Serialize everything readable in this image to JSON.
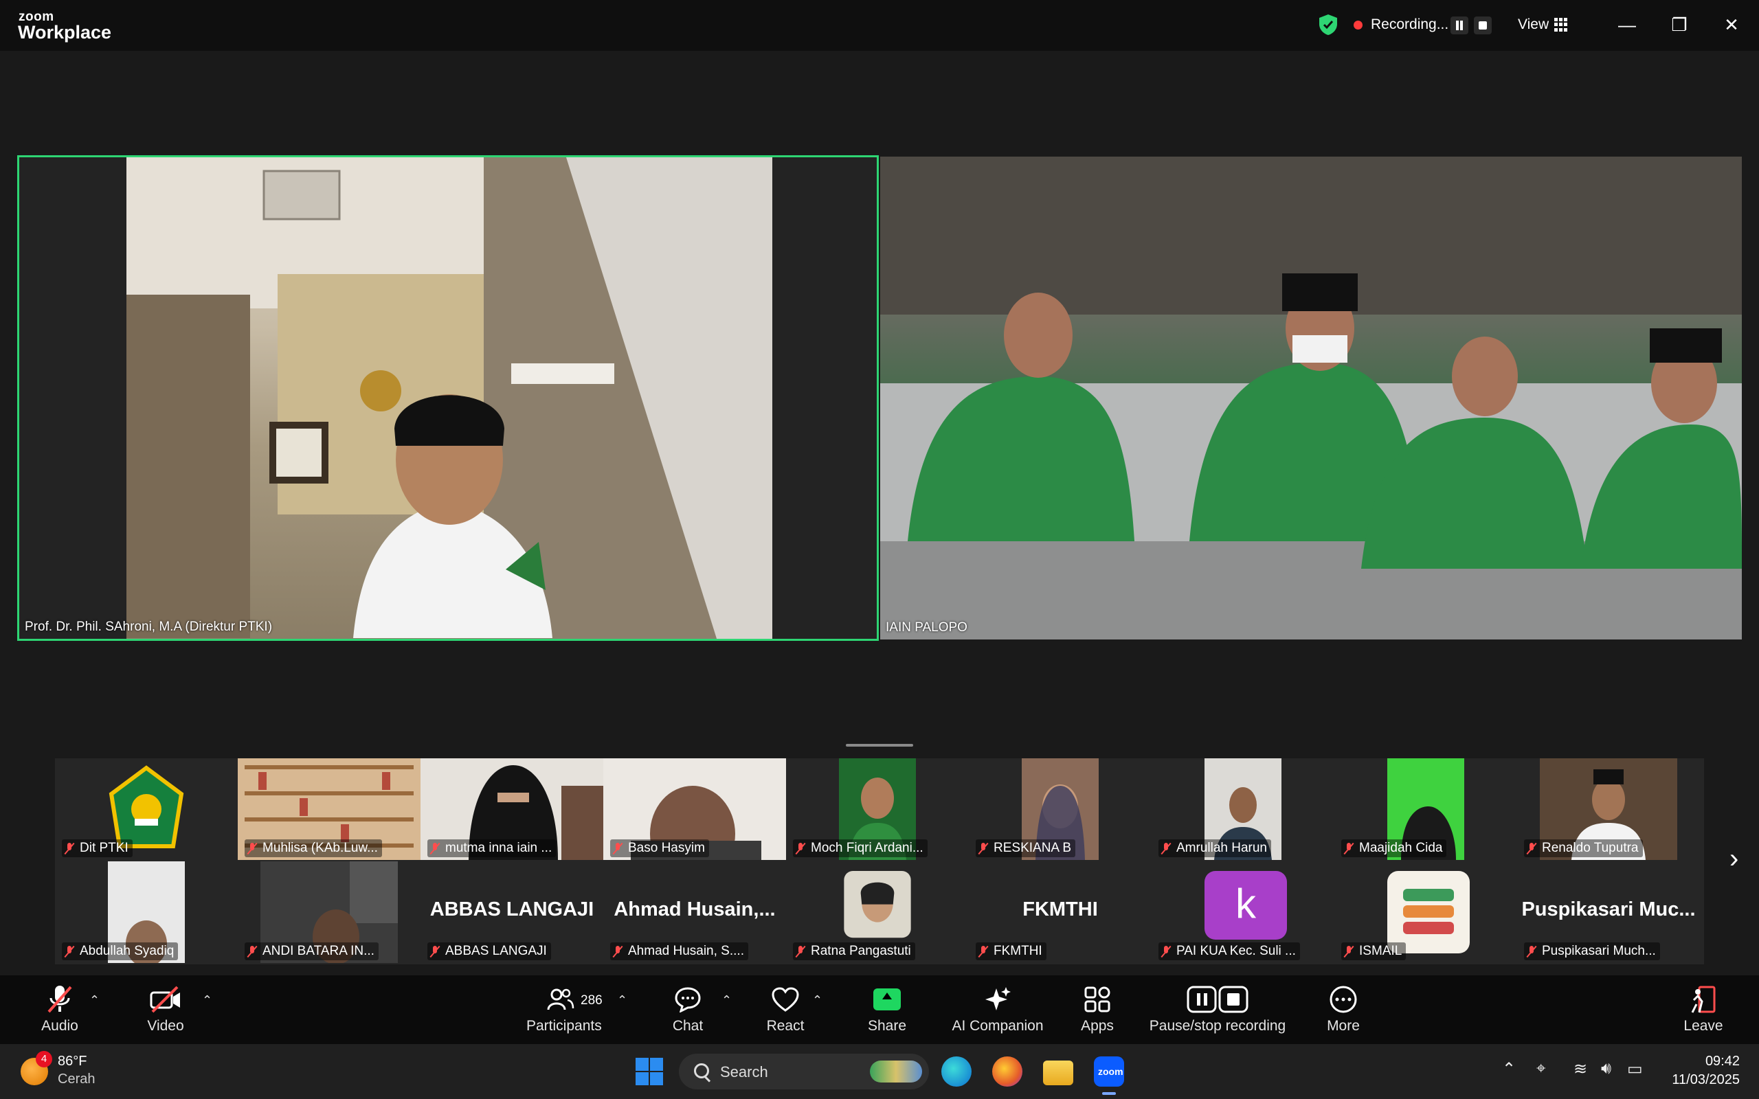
{
  "app": {
    "brand_small": "zoom",
    "brand_big": "Workplace"
  },
  "recording": {
    "label": "Recording..."
  },
  "view": {
    "label": "View"
  },
  "colors": {
    "accent": "#2ed573",
    "muted": "#ff4d4d",
    "share": "#1ed760"
  },
  "tiles": {
    "speaker": {
      "name": "Prof. Dr. Phil. SAhroni, M.A (Direktur PTKI)"
    },
    "room": {
      "name": "IAIN PALOPO"
    }
  },
  "participants_row1": [
    {
      "name": "Dit PTKI",
      "kind": "logo"
    },
    {
      "name": "Muhlisa (KAb.Luw...",
      "kind": "video"
    },
    {
      "name": "mutma inna iain ...",
      "kind": "video"
    },
    {
      "name": "Baso Hasyim",
      "kind": "video"
    },
    {
      "name": "Moch Fiqri Ardani...",
      "kind": "video"
    },
    {
      "name": "RESKIANA B",
      "kind": "video"
    },
    {
      "name": "Amrullah Harun",
      "kind": "video"
    },
    {
      "name": "Maajidah Cida",
      "kind": "video"
    },
    {
      "name": "Renaldo Tuputra",
      "kind": "video"
    }
  ],
  "participants_row2": [
    {
      "name": "Abdullah Syadiq",
      "big": ""
    },
    {
      "name": "ANDI BATARA IN...",
      "big": ""
    },
    {
      "name": "ABBAS LANGAJI",
      "big": "ABBAS LANGAJI"
    },
    {
      "name": "Ahmad Husain, S....",
      "big": "Ahmad  Husain,..."
    },
    {
      "name": "Ratna Pangastuti",
      "big": ""
    },
    {
      "name": "FKMTHI",
      "big": "FKMTHI"
    },
    {
      "name": "PAI KUA Kec. Suli ...",
      "big": "",
      "avatar_letter": "k"
    },
    {
      "name": "ISMAIL",
      "big": ""
    },
    {
      "name": "Puspikasari Much...",
      "big": "Puspikasari  Muc..."
    }
  ],
  "toolbar": {
    "audio": "Audio",
    "video": "Video",
    "participants": "Participants",
    "participants_count": "286",
    "chat": "Chat",
    "react": "React",
    "share": "Share",
    "ai": "AI Companion",
    "apps": "Apps",
    "recording": "Pause/stop recording",
    "more": "More",
    "leave": "Leave"
  },
  "taskbar": {
    "temp": "86°F",
    "condition": "Cerah",
    "badge": "4",
    "search": "Search",
    "time": "09:42",
    "date": "11/03/2025"
  }
}
